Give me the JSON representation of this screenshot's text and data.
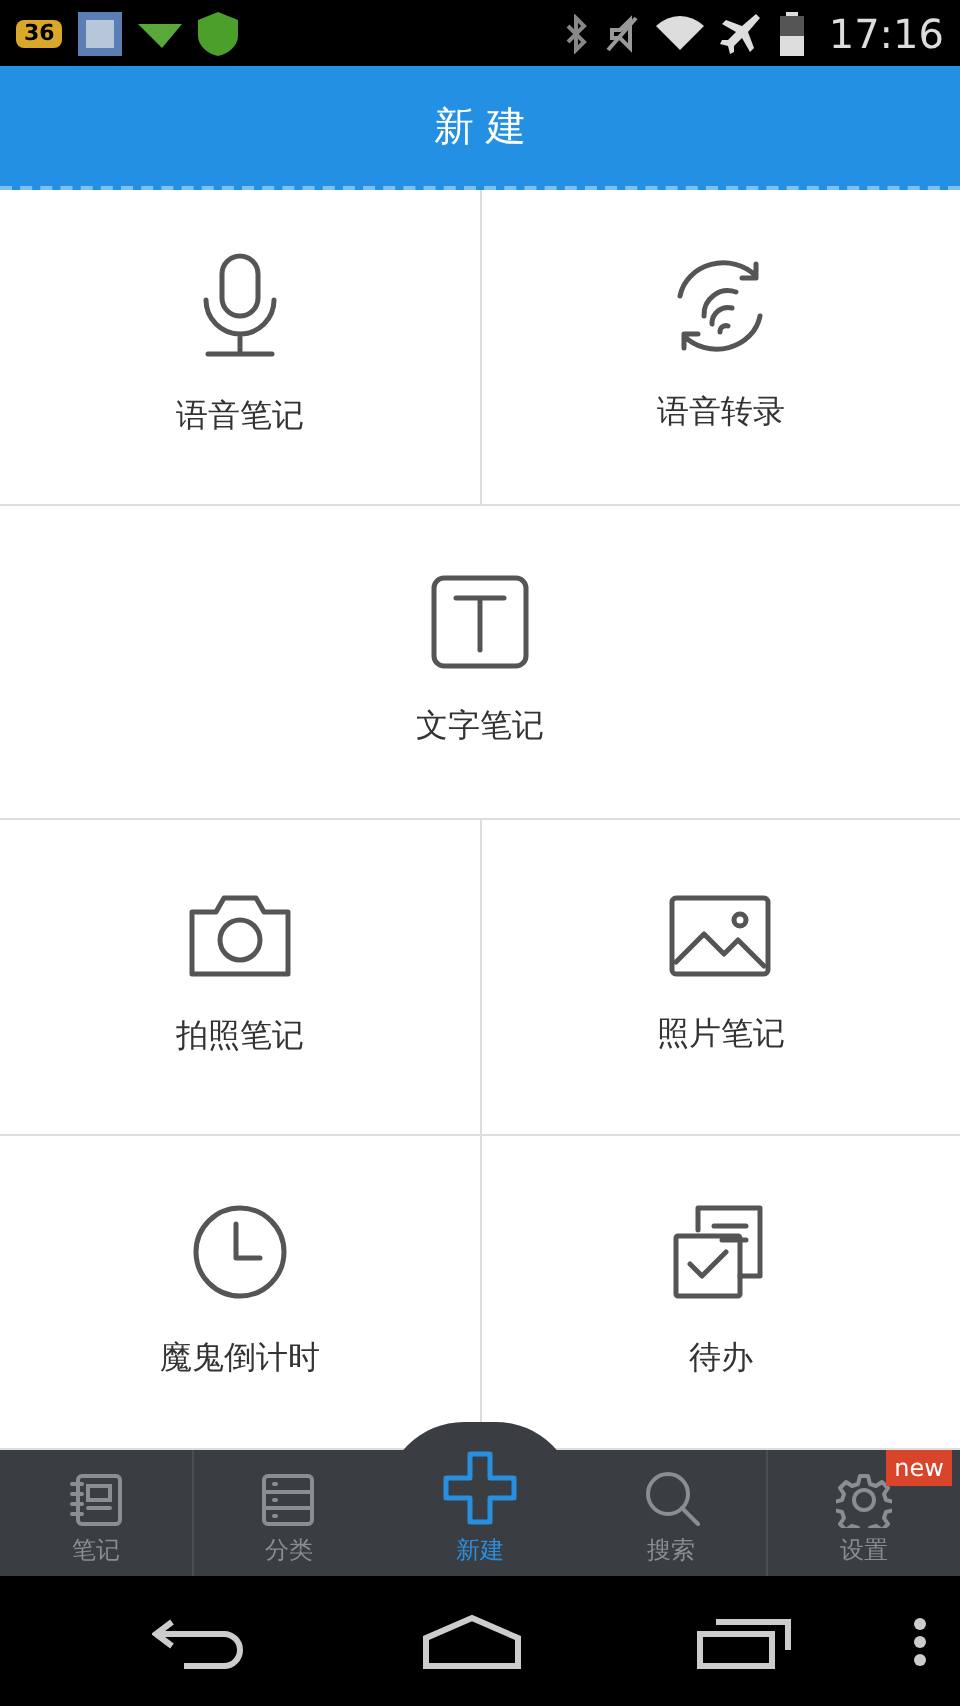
{
  "status_bar": {
    "badge": "36",
    "time": "17:16"
  },
  "header": {
    "title": "新 建"
  },
  "grid": [
    [
      {
        "kind": "microphone",
        "label": "语音笔记"
      },
      {
        "kind": "transcribe",
        "label": "语音转录"
      }
    ],
    [
      {
        "kind": "text",
        "label": "文字笔记"
      }
    ],
    [
      {
        "kind": "camera",
        "label": "拍照笔记"
      },
      {
        "kind": "photo",
        "label": "照片笔记"
      }
    ],
    [
      {
        "kind": "clock",
        "label": "魔鬼倒计时"
      },
      {
        "kind": "todo",
        "label": "待办"
      }
    ]
  ],
  "tabs": [
    {
      "kind": "notes",
      "label": "笔记",
      "selected": false
    },
    {
      "kind": "category",
      "label": "分类",
      "selected": false
    },
    {
      "kind": "new",
      "label": "新建",
      "selected": true
    },
    {
      "kind": "search",
      "label": "搜索",
      "selected": false
    },
    {
      "kind": "settings",
      "label": "设置",
      "selected": false,
      "badge": "new"
    }
  ]
}
